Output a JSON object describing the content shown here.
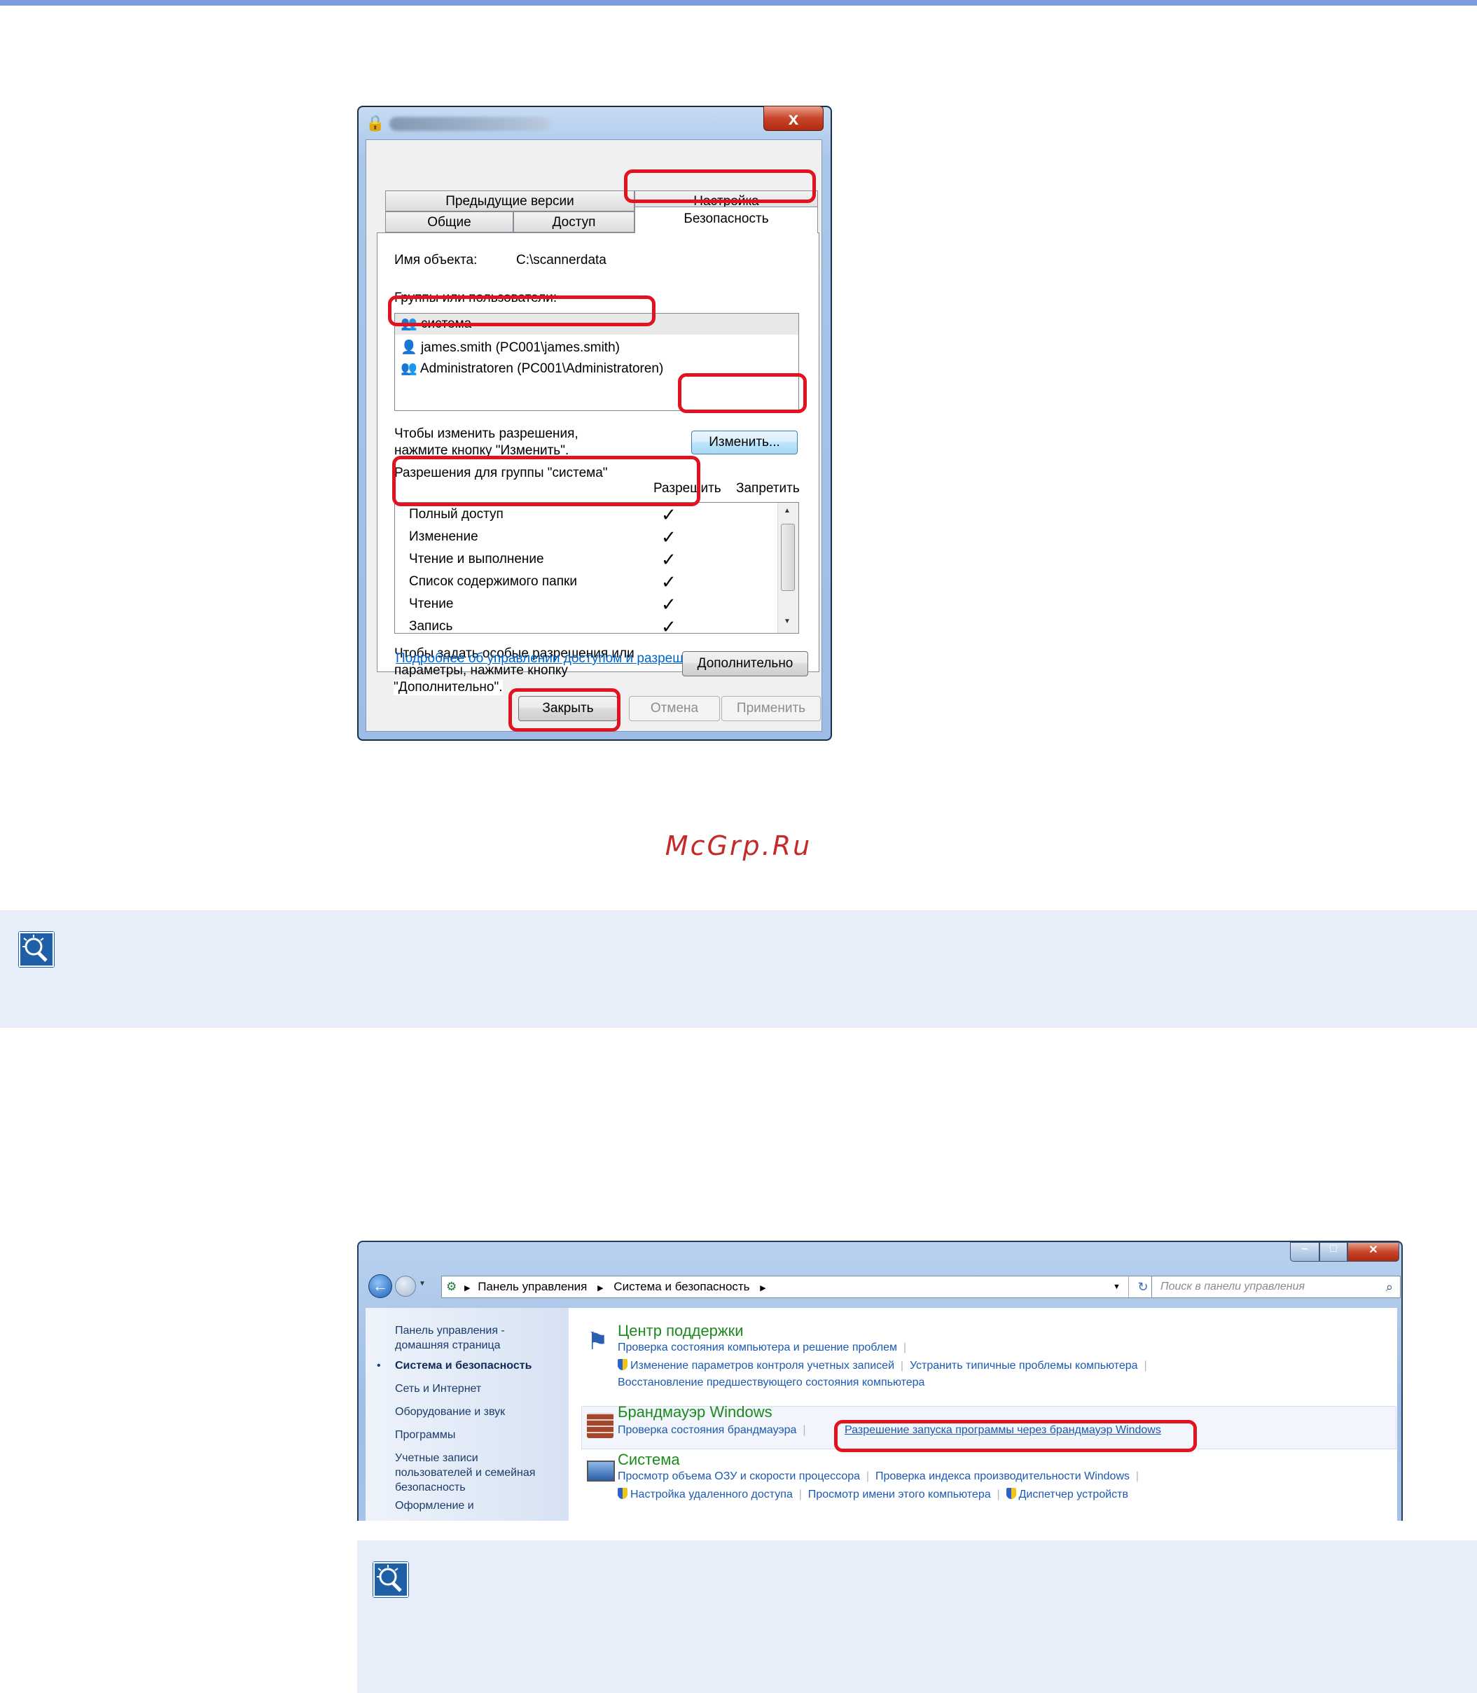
{
  "dialog": {
    "tabs_row1": [
      "Предыдущие версии",
      "Настройка"
    ],
    "tabs_row2": [
      "Общие",
      "Доступ",
      "Безопасность"
    ],
    "object_name_label": "Имя объекта:",
    "object_name_value": "C:\\scannerdata",
    "groups_label": "Группы или пользователи:",
    "users": [
      "система",
      "james.smith (PC001\\james.smith)",
      "Administratoren (PC001\\Administratoren)"
    ],
    "change_hint_line1": "Чтобы изменить разрешения,",
    "change_hint_line2": "нажмите кнопку \"Изменить\".",
    "change_button": "Изменить...",
    "perm_group_label": "Разрешения для группы \"система\"",
    "col_allow": "Разрешить",
    "col_deny": "Запретить",
    "permissions": [
      {
        "name": "Полный доступ",
        "allow": "✓"
      },
      {
        "name": "Изменение",
        "allow": "✓"
      },
      {
        "name": "Чтение и выполнение",
        "allow": "✓"
      },
      {
        "name": "Список содержимого папки",
        "allow": "✓"
      },
      {
        "name": "Чтение",
        "allow": "✓"
      },
      {
        "name": "Запись",
        "allow": "✓"
      }
    ],
    "special_hint_line1": "Чтобы задать особые разрешения или",
    "special_hint_line2": "параметры, нажмите кнопку",
    "special_hint_line3": "\"Дополнительно\".",
    "advanced_button": "Дополнительно",
    "more_link": "Подробнее об управлении доступом и разрешениях",
    "close_button": "Закрыть",
    "cancel_button": "Отмена",
    "apply_button": "Применить",
    "close_x": "x"
  },
  "watermark": "McGrp.Ru",
  "control_panel": {
    "breadcrumb": [
      "Панель управления",
      "Система и безопасность"
    ],
    "search_placeholder": "Поиск в панели управления",
    "nav": {
      "home_line1": "Панель управления -",
      "home_line2": "домашняя страница",
      "current": "Система и безопасность",
      "items": [
        "Сеть и Интернет",
        "Оборудование и звук",
        "Программы"
      ],
      "accounts_line1": "Учетные записи",
      "accounts_line2": "пользователей и семейная",
      "accounts_line3": "безопасность",
      "cut_item": "Оформление и"
    },
    "support": {
      "title": "Центр поддержки",
      "link1": "Проверка состояния компьютера и решение проблем",
      "link2": "Изменение параметров контроля учетных записей",
      "link3": "Устранить типичные проблемы компьютера",
      "link4": "Восстановление предшествующего состояния компьютера"
    },
    "firewall": {
      "title": "Брандмауэр Windows",
      "link1": "Проверка состояния брандмауэра",
      "link2": "Разрешение запуска программы через брандмауэр Windows"
    },
    "system": {
      "title": "Система",
      "link1": "Просмотр объема ОЗУ и скорости процессора",
      "link2": "Проверка индекса производительности Windows",
      "link3": "Настройка удаленного доступа",
      "link4": "Просмотр имени этого компьютера",
      "link5": "Диспетчер устройств"
    }
  },
  "colors": {
    "highlight_red": "#e0131f",
    "note_background": "#e7eefa",
    "link_blue": "#1c59b3",
    "category_green": "#1e8a1e"
  }
}
